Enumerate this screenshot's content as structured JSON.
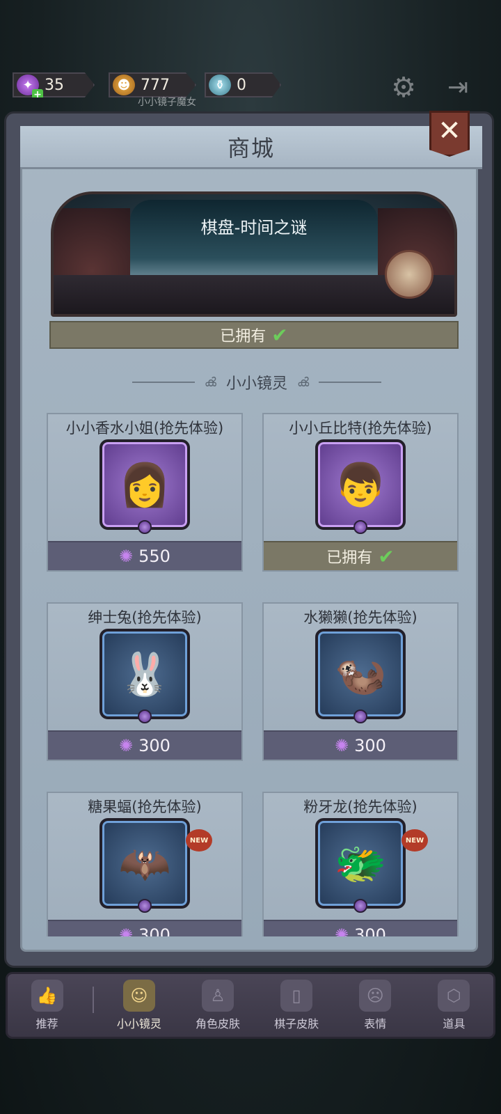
{
  "hud": {
    "candy": "35",
    "pumpkin": "777",
    "potion": "0",
    "witch_label": "小小镜子魔女"
  },
  "shop": {
    "title": "商城",
    "banner": {
      "name": "棋盘-时间之谜",
      "status": "已拥有"
    },
    "section_title": "小小镜灵",
    "items": [
      {
        "name": "小小香水小姐(抢先体验)",
        "price": "550",
        "owned": false,
        "new": false,
        "frame": "purple"
      },
      {
        "name": "小小丘比特(抢先体验)",
        "price": "已拥有",
        "owned": true,
        "new": false,
        "frame": "purple"
      },
      {
        "name": "绅士兔(抢先体验)",
        "price": "300",
        "owned": false,
        "new": false,
        "frame": "blue"
      },
      {
        "name": "水獭獭(抢先体验)",
        "price": "300",
        "owned": false,
        "new": false,
        "frame": "blue"
      },
      {
        "name": "糖果蝠(抢先体验)",
        "price": "300",
        "owned": false,
        "new": true,
        "frame": "blue"
      },
      {
        "name": "粉牙龙(抢先体验)",
        "price": "300",
        "owned": false,
        "new": true,
        "frame": "blue"
      }
    ],
    "new_badge": "NEW"
  },
  "nav": {
    "items": [
      {
        "label": "推荐",
        "icon": "thumbs-up-icon"
      },
      {
        "label": "小小镜灵",
        "icon": "mirror-spirit-icon",
        "active": true
      },
      {
        "label": "角色皮肤",
        "icon": "character-skin-icon"
      },
      {
        "label": "棋子皮肤",
        "icon": "piece-skin-icon"
      },
      {
        "label": "表情",
        "icon": "emote-icon"
      },
      {
        "label": "道具",
        "icon": "item-icon"
      }
    ]
  },
  "colors": {
    "panel": "#4b4f5e",
    "card": "#a7b6c3",
    "price_bar": "#5d5e76",
    "owned_bar": "#7b7866",
    "check": "#6ccd5b",
    "close_button": "#7a3a2f"
  }
}
